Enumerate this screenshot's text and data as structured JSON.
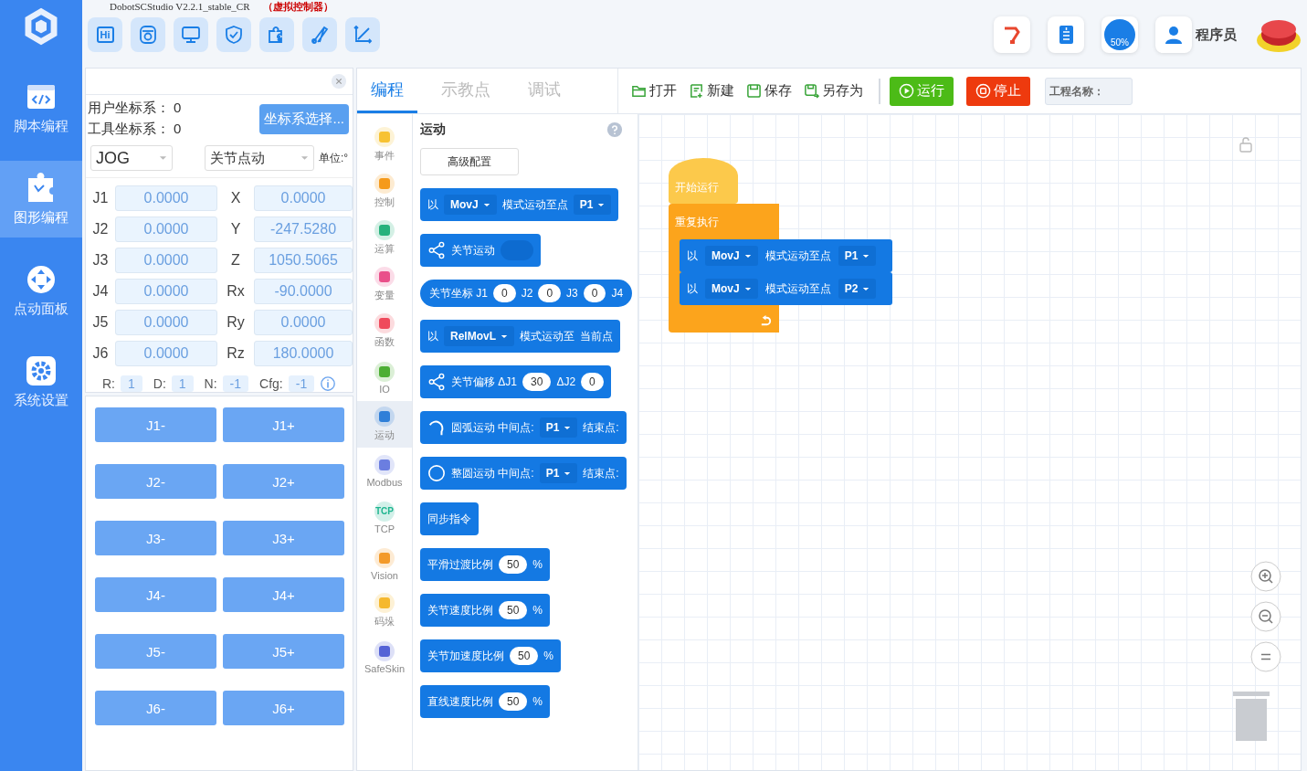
{
  "window": {
    "title": "DobotSCStudio V2.2.1_stable_CR",
    "note": "（虚拟控制器）"
  },
  "sidebar": {
    "items": [
      {
        "label": "脚本编程",
        "kind": "code",
        "selected": false
      },
      {
        "label": "图形编程",
        "kind": "puzzle",
        "selected": true
      },
      {
        "label": "点动面板",
        "kind": "jog",
        "selected": false
      },
      {
        "label": "系统设置",
        "kind": "gear",
        "selected": false
      }
    ]
  },
  "tools": [
    {
      "kind": "hi",
      "text": "Hi"
    },
    {
      "kind": "camera"
    },
    {
      "kind": "monitor"
    },
    {
      "kind": "shield"
    },
    {
      "kind": "puzzle"
    },
    {
      "kind": "arm"
    },
    {
      "kind": "axis"
    }
  ],
  "status": {
    "speed": "50%",
    "user": "程序员"
  },
  "coord_panel": {
    "user_frame_label": "用户坐标系：",
    "user_frame": "0",
    "tool_frame_label": "工具坐标系：",
    "tool_frame": "0",
    "select_button": "坐标系选择...",
    "mode": "JOG",
    "jog_type": "关节点动",
    "unit": "单位:°",
    "joints": [
      {
        "label": "J1",
        "value": "0.0000"
      },
      {
        "label": "J2",
        "value": "0.0000"
      },
      {
        "label": "J3",
        "value": "0.0000"
      },
      {
        "label": "J4",
        "value": "0.0000"
      },
      {
        "label": "J5",
        "value": "0.0000"
      },
      {
        "label": "J6",
        "value": "0.0000"
      }
    ],
    "pose": [
      {
        "label": "X",
        "value": "0.0000"
      },
      {
        "label": "Y",
        "value": "-247.5280"
      },
      {
        "label": "Z",
        "value": "1050.5065"
      },
      {
        "label": "Rx",
        "value": "-90.0000"
      },
      {
        "label": "Ry",
        "value": "0.0000"
      },
      {
        "label": "Rz",
        "value": "180.0000"
      }
    ],
    "config": [
      {
        "label": "R:",
        "value": "1"
      },
      {
        "label": "D:",
        "value": "1"
      },
      {
        "label": "N:",
        "value": "-1"
      },
      {
        "label": "Cfg:",
        "value": "-1"
      }
    ]
  },
  "jog_buttons": [
    {
      "minus": "J1-",
      "plus": "J1+"
    },
    {
      "minus": "J2-",
      "plus": "J2+"
    },
    {
      "minus": "J3-",
      "plus": "J3+"
    },
    {
      "minus": "J4-",
      "plus": "J4+"
    },
    {
      "minus": "J5-",
      "plus": "J5+"
    },
    {
      "minus": "J6-",
      "plus": "J6+"
    }
  ],
  "tabs": [
    {
      "label": "编程",
      "selected": true
    },
    {
      "label": "示教点",
      "selected": false
    },
    {
      "label": "调试",
      "selected": false
    }
  ],
  "file_actions": [
    {
      "label": "打开",
      "kind": "open"
    },
    {
      "label": "新建",
      "kind": "new"
    },
    {
      "label": "保存",
      "kind": "save"
    },
    {
      "label": "另存为",
      "kind": "saveas"
    }
  ],
  "run_button": "运行",
  "stop_button": "停止",
  "project_name": {
    "placeholder": "工程名称："
  },
  "categories": [
    {
      "label": "事件",
      "color": "#f7c232",
      "selected": false
    },
    {
      "label": "控制",
      "color": "#f59a1b",
      "selected": false
    },
    {
      "label": "运算",
      "color": "#27b27c",
      "selected": false
    },
    {
      "label": "变量",
      "color": "#e9508a",
      "selected": false
    },
    {
      "label": "函数",
      "color": "#ef4a5c",
      "selected": false
    },
    {
      "label": "IO",
      "color": "#4cae33",
      "selected": false
    },
    {
      "label": "运动",
      "color": "#2f7fd8",
      "selected": true
    },
    {
      "label": "Modbus",
      "color": "#6b7ee0",
      "selected": false
    },
    {
      "label": "TCP",
      "color": "#1fb58f",
      "selected": false,
      "icon_text": "TCP"
    },
    {
      "label": "Vision",
      "color": "#f39a2a",
      "selected": false
    },
    {
      "label": "码垛",
      "color": "#f5b82e",
      "selected": false
    },
    {
      "label": "SafeSkin",
      "color": "#5563d6",
      "selected": false
    }
  ],
  "palette": {
    "title": "运动",
    "config_button": "高级配置",
    "blocks": [
      {
        "kind": "stack",
        "parts": [
          {
            "kind": "text",
            "text": "以"
          },
          {
            "kind": "dropdown",
            "text": "MovJ"
          },
          {
            "kind": "text",
            "text": "模式运动至点"
          },
          {
            "kind": "dropdown",
            "text": "P1"
          }
        ]
      },
      {
        "kind": "share",
        "parts": [
          {
            "kind": "text",
            "text": "关节运动"
          },
          {
            "kind": "slot"
          }
        ]
      },
      {
        "kind": "reporter",
        "parts": [
          {
            "kind": "text",
            "text": "关节坐标 J1"
          },
          {
            "kind": "number",
            "text": "0"
          },
          {
            "kind": "text",
            "text": "J2"
          },
          {
            "kind": "number",
            "text": "0"
          },
          {
            "kind": "text",
            "text": "J3"
          },
          {
            "kind": "number",
            "text": "0"
          },
          {
            "kind": "text",
            "text": "J4"
          }
        ]
      },
      {
        "kind": "stack",
        "parts": [
          {
            "kind": "text",
            "text": "以"
          },
          {
            "kind": "dropdown",
            "text": "RelMovL"
          },
          {
            "kind": "text",
            "text": "模式运动至"
          },
          {
            "kind": "text",
            "text": "当前点"
          }
        ]
      },
      {
        "kind": "share",
        "parts": [
          {
            "kind": "text",
            "text": "关节偏移 ΔJ1"
          },
          {
            "kind": "number",
            "text": "30"
          },
          {
            "kind": "text",
            "text": "ΔJ2"
          },
          {
            "kind": "number",
            "text": "0"
          }
        ]
      },
      {
        "kind": "arc",
        "parts": [
          {
            "kind": "text",
            "text": "圆弧运动 中间点:"
          },
          {
            "kind": "dropdown",
            "text": "P1"
          },
          {
            "kind": "text",
            "text": "结束点:"
          }
        ]
      },
      {
        "kind": "circle",
        "parts": [
          {
            "kind": "text",
            "text": "整圆运动 中间点:"
          },
          {
            "kind": "dropdown",
            "text": "P1"
          },
          {
            "kind": "text",
            "text": "结束点:"
          }
        ]
      },
      {
        "kind": "stack",
        "parts": [
          {
            "kind": "text",
            "text": "同步指令"
          }
        ]
      },
      {
        "kind": "stack",
        "parts": [
          {
            "kind": "text",
            "text": "平滑过渡比例"
          },
          {
            "kind": "number",
            "text": "50"
          },
          {
            "kind": "text",
            "text": "%"
          }
        ]
      },
      {
        "kind": "stack",
        "parts": [
          {
            "kind": "text",
            "text": "关节速度比例"
          },
          {
            "kind": "number",
            "text": "50"
          },
          {
            "kind": "text",
            "text": "%"
          }
        ]
      },
      {
        "kind": "stack",
        "parts": [
          {
            "kind": "text",
            "text": "关节加速度比例"
          },
          {
            "kind": "number",
            "text": "50"
          },
          {
            "kind": "text",
            "text": "%"
          }
        ]
      },
      {
        "kind": "stack",
        "parts": [
          {
            "kind": "text",
            "text": "直线速度比例"
          },
          {
            "kind": "number",
            "text": "50"
          },
          {
            "kind": "text",
            "text": "%"
          }
        ]
      }
    ]
  },
  "canvas": {
    "start_block": "开始运行",
    "loop_block": "重复执行",
    "blocks": [
      {
        "parts": [
          {
            "kind": "text",
            "text": "以"
          },
          {
            "kind": "dropdown",
            "text": "MovJ"
          },
          {
            "kind": "text",
            "text": "模式运动至点"
          },
          {
            "kind": "dropdown",
            "text": "P1"
          }
        ]
      },
      {
        "parts": [
          {
            "kind": "text",
            "text": "以"
          },
          {
            "kind": "dropdown",
            "text": "MovJ"
          },
          {
            "kind": "text",
            "text": "模式运动至点"
          },
          {
            "kind": "dropdown",
            "text": "P2"
          }
        ]
      }
    ]
  }
}
